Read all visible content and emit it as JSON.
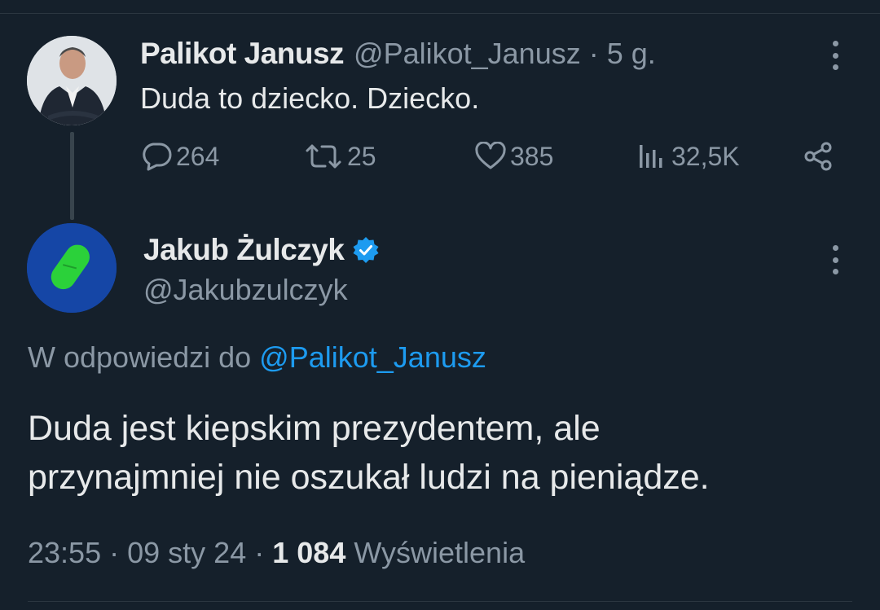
{
  "parent_tweet": {
    "author_name": "Palikot Janusz",
    "handle": "@Palikot_Janusz",
    "separator": "·",
    "time_ago": "5 g.",
    "text": "Duda to dziecko. Dziecko.",
    "stats": {
      "replies": "264",
      "retweets": "25",
      "likes": "385",
      "views": "32,5K"
    }
  },
  "reply_tweet": {
    "author_name": "Jakub Żulczyk",
    "verified": true,
    "handle": "@Jakubzulczyk",
    "reply_to_prefix": "W odpowiedzi do",
    "reply_to_handle": "@Palikot_Janusz",
    "text_lines": [
      "Duda jest kiepskim prezydentem, ale",
      "przynajmniej nie oszukał ludzi na pieniądze."
    ],
    "time": "23:55",
    "date": "09 sty 24",
    "separator": "·",
    "views_count": "1 084",
    "views_label": "Wyświetlenia"
  },
  "icons": {
    "reply": "speech-bubble-icon",
    "retweet": "retweet-icon",
    "like": "heart-icon",
    "views": "bar-chart-icon",
    "share": "share-icon",
    "more": "vertical-dots-icon",
    "verified": "verified-badge-icon"
  },
  "colors": {
    "background": "#15202b",
    "text_primary": "#e7e9ea",
    "text_secondary": "#8b98a5",
    "accent": "#1d9bf0"
  }
}
